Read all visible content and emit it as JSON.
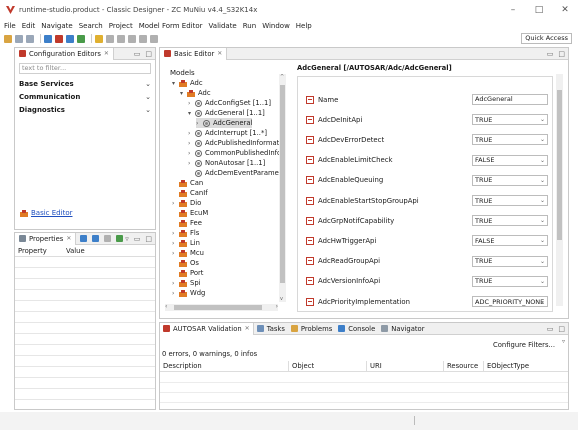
{
  "window": {
    "title": "runtime-studio.product - Classic Designer - ZC MuNiu v4.4_S32K14x",
    "controls": [
      "–",
      "□",
      "✕"
    ]
  },
  "menu": [
    "File",
    "Edit",
    "Navigate",
    "Search",
    "Project",
    "Model Form Editor",
    "Validate",
    "Run",
    "Window",
    "Help"
  ],
  "toolbar": {
    "quick_access": "Quick Access"
  },
  "config_panel": {
    "title": "Configuration Editors",
    "filter_placeholder": "text to filter...",
    "categories": [
      "Base Services",
      "Communication",
      "Diagnostics"
    ],
    "link": "Basic Editor"
  },
  "properties_panel": {
    "title": "Properties",
    "columns": [
      "Property",
      "Value"
    ]
  },
  "editor": {
    "tab": "Basic Editor",
    "tree_header": "Models",
    "tree": [
      {
        "label": "Adc",
        "twisty": "▾"
      },
      {
        "label": "Adc",
        "twisty": "▾"
      },
      {
        "label": "AdcConfigSet [1..1]",
        "twisty": "›"
      },
      {
        "label": "AdcGeneral [1..1]",
        "twisty": "▾"
      },
      {
        "label": "AdcGeneral",
        "twisty": "›"
      },
      {
        "label": "AdcInterrupt [1..*]",
        "twisty": "›"
      },
      {
        "label": "AdcPublishedInformatic",
        "twisty": "›"
      },
      {
        "label": "CommonPublishedInfor",
        "twisty": "›"
      },
      {
        "label": "NonAutosar [1..1]",
        "twisty": "›"
      },
      {
        "label": "AdcDemEventParamete",
        "twisty": ""
      },
      {
        "label": "Can",
        "twisty": ""
      },
      {
        "label": "CanIf",
        "twisty": ""
      },
      {
        "label": "Dio",
        "twisty": "›"
      },
      {
        "label": "EcuM",
        "twisty": ""
      },
      {
        "label": "Fee",
        "twisty": ""
      },
      {
        "label": "Fls",
        "twisty": "›"
      },
      {
        "label": "Lin",
        "twisty": "›"
      },
      {
        "label": "Mcu",
        "twisty": "›"
      },
      {
        "label": "Os",
        "twisty": ""
      },
      {
        "label": "Port",
        "twisty": ""
      },
      {
        "label": "Spi",
        "twisty": "›"
      },
      {
        "label": "Wdg",
        "twisty": "›"
      }
    ],
    "form_title": "AdcGeneral [/AUTOSAR/Adc/AdcGeneral]",
    "fields": [
      {
        "label": "Name",
        "value": "AdcGeneral",
        "kind": "text"
      },
      {
        "label": "AdcDeInitApi",
        "value": "TRUE",
        "kind": "select"
      },
      {
        "label": "AdcDevErrorDetect",
        "value": "TRUE",
        "kind": "select"
      },
      {
        "label": "AdcEnableLimitCheck",
        "value": "FALSE",
        "kind": "select"
      },
      {
        "label": "AdcEnableQueuing",
        "value": "TRUE",
        "kind": "select"
      },
      {
        "label": "AdcEnableStartStopGroupApi",
        "value": "TRUE",
        "kind": "select"
      },
      {
        "label": "AdcGrpNotifCapability",
        "value": "TRUE",
        "kind": "select"
      },
      {
        "label": "AdcHwTriggerApi",
        "value": "FALSE",
        "kind": "select"
      },
      {
        "label": "AdcReadGroupApi",
        "value": "TRUE",
        "kind": "select"
      },
      {
        "label": "AdcVersionInfoApi",
        "value": "TRUE",
        "kind": "select"
      },
      {
        "label": "AdcPriorityImplementation",
        "value": "ADC_PRIORITY_NONE",
        "kind": "select"
      }
    ]
  },
  "bottom_panel": {
    "tabs": [
      "AUTOSAR Validation",
      "Tasks",
      "Problems",
      "Console",
      "Navigator"
    ],
    "status": "0 errors, 0 warnings, 0 infos",
    "configure_filters": "Configure Filters...",
    "columns": [
      "Description",
      "Object",
      "URI",
      "Resource",
      "EObjectType"
    ]
  }
}
